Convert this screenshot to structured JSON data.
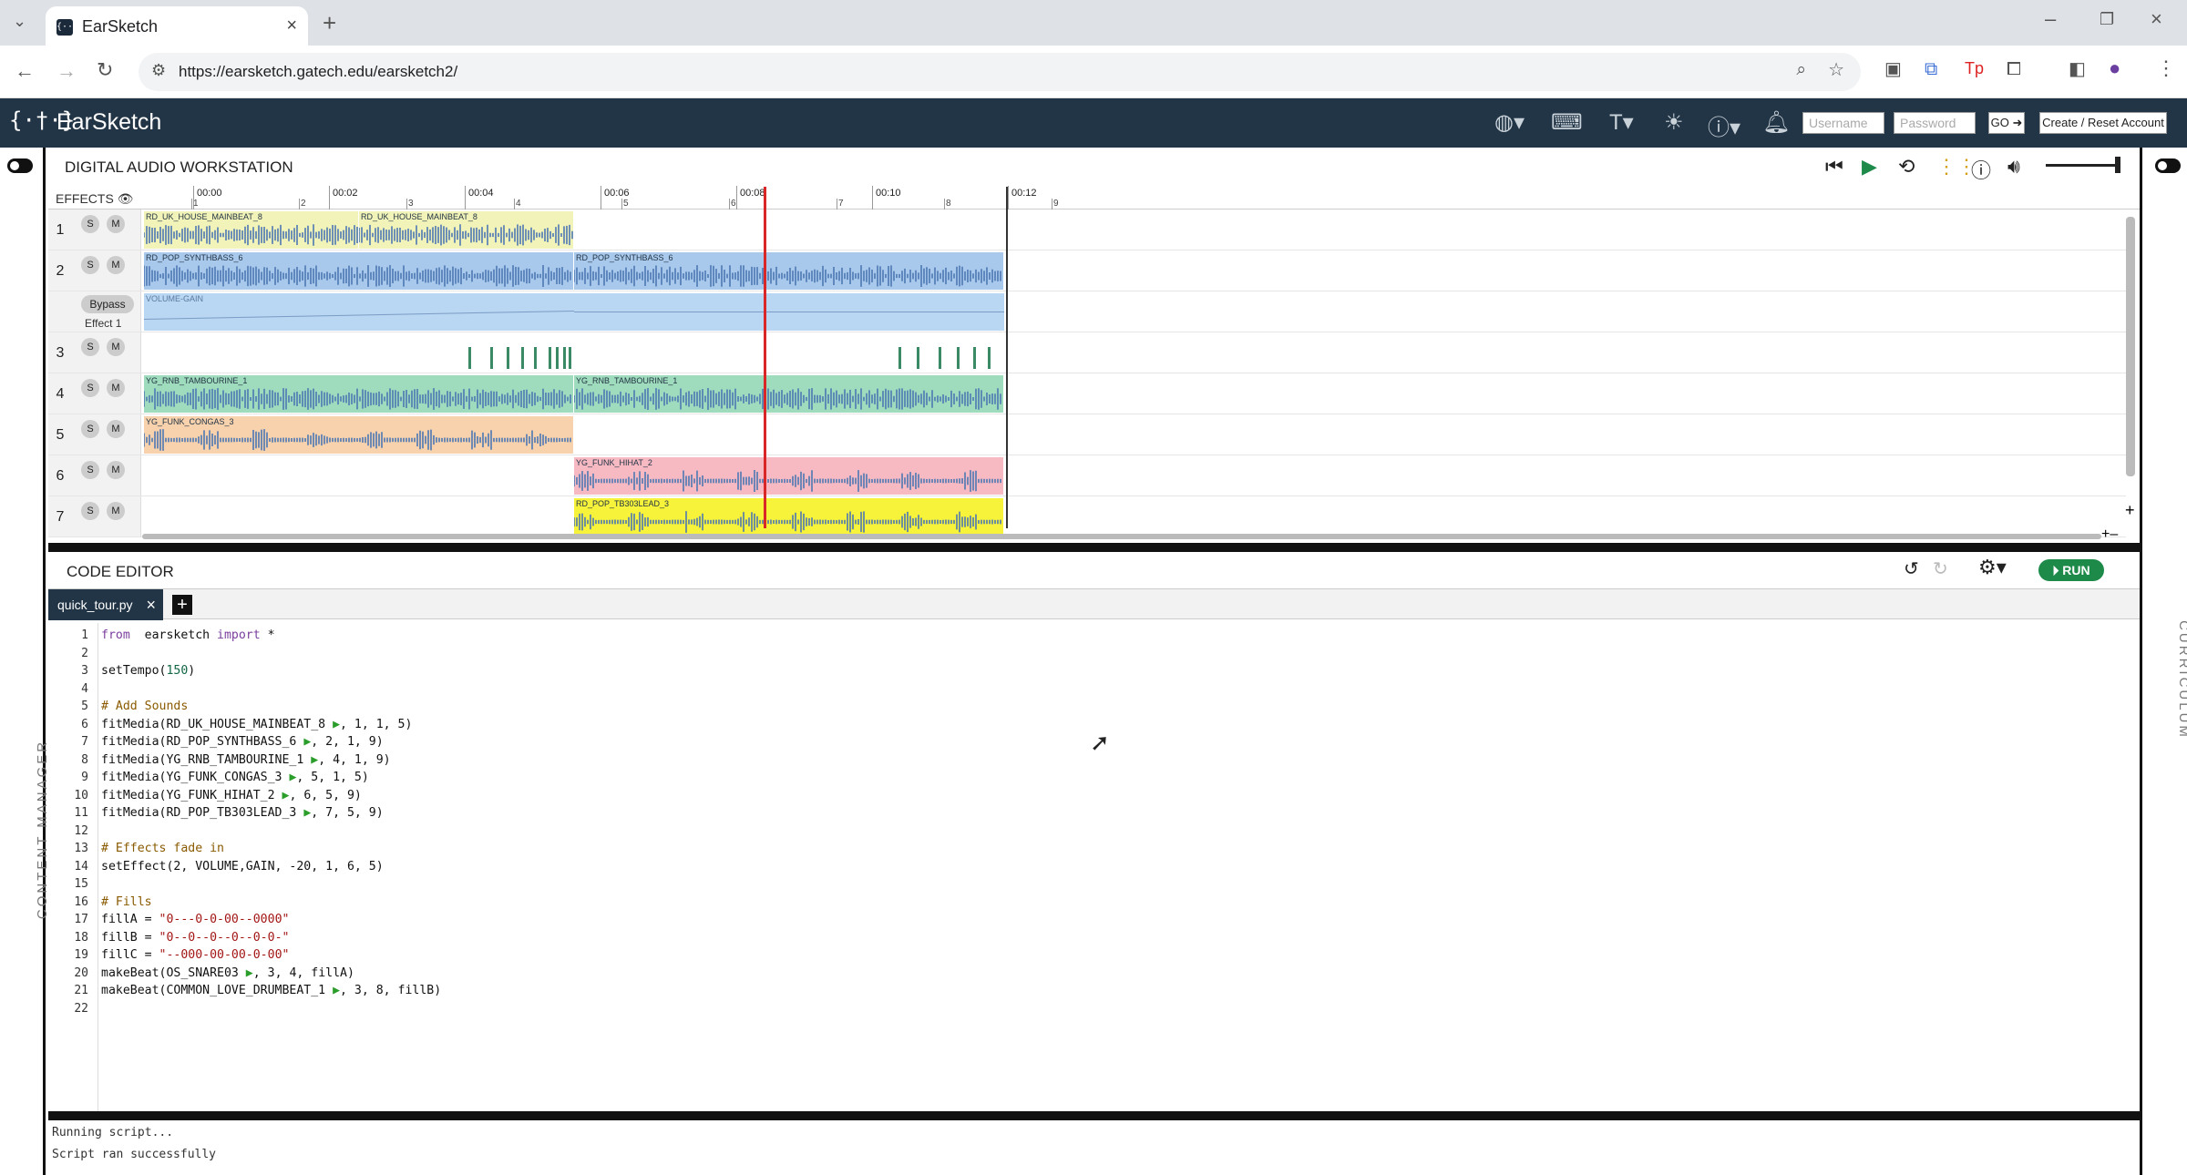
{
  "browser": {
    "tab_title": "EarSketch",
    "tab_favicon": "{··}",
    "url": "https://earsketch.gatech.edu/earsketch2/"
  },
  "app": {
    "logo": "{·†·}",
    "name": "EarSketch",
    "username_placeholder": "Username",
    "password_placeholder": "Password",
    "go_label": "GO",
    "create_account_label": "Create / Reset Account"
  },
  "side": {
    "left_label": "CONTENT MANAGER",
    "right_label": "CURRICULUM"
  },
  "daw": {
    "title": "DIGITAL AUDIO WORKSTATION",
    "effects_label": "EFFECTS",
    "time_labels": [
      "00:00",
      "00:02",
      "00:04",
      "00:06",
      "00:08",
      "00:10",
      "00:12"
    ],
    "measure_labels": [
      "1",
      "2",
      "3",
      "4",
      "5",
      "6",
      "7",
      "8",
      "9"
    ],
    "bypass_label": "Bypass",
    "effect_label": "Effect 1",
    "effect_clip": "VOLUME-GAIN",
    "tracks": [
      {
        "num": "1",
        "color": "#f1f3b8",
        "wave": "#4d78b3",
        "clips": [
          {
            "name": "RD_UK_HOUSE_MAINBEAT_8",
            "m1": 1,
            "m2": 3
          },
          {
            "name": "RD_UK_HOUSE_MAINBEAT_8",
            "m1": 3,
            "m2": 5
          }
        ]
      },
      {
        "num": "2",
        "color": "#a9c9ec",
        "wave": "#4d78b3",
        "clips": [
          {
            "name": "RD_POP_SYNTHBASS_6",
            "m1": 1,
            "m2": 5
          },
          {
            "name": "RD_POP_SYNTHBASS_6",
            "m1": 5,
            "m2": 9
          }
        ]
      },
      {
        "num": "3",
        "color": "#ffffff",
        "wave": "#3a8a66",
        "clips": [
          {
            "name": "",
            "m1": 1,
            "m2": 5
          },
          {
            "name": "",
            "m1": 5,
            "m2": 9
          }
        ]
      },
      {
        "num": "4",
        "color": "#9fdcbd",
        "wave": "#4d78b3",
        "clips": [
          {
            "name": "YG_RNB_TAMBOURINE_1",
            "m1": 1,
            "m2": 5
          },
          {
            "name": "YG_RNB_TAMBOURINE_1",
            "m1": 5,
            "m2": 9
          }
        ]
      },
      {
        "num": "5",
        "color": "#f7d2ad",
        "wave": "#4d78b3",
        "clips": [
          {
            "name": "YG_FUNK_CONGAS_3",
            "m1": 1,
            "m2": 5
          }
        ]
      },
      {
        "num": "6",
        "color": "#f7bac3",
        "wave": "#4d78b3",
        "clips": [
          {
            "name": "YG_FUNK_HIHAT_2",
            "m1": 5,
            "m2": 9
          }
        ]
      },
      {
        "num": "7",
        "color": "#f7f33a",
        "wave": "#4d78b3",
        "clips": [
          {
            "name": "RD_POP_TB303LEAD_3",
            "m1": 5,
            "m2": 9
          }
        ]
      }
    ],
    "solo_label": "S",
    "mute_label": "M"
  },
  "editor": {
    "title": "CODE EDITOR",
    "file_tab": "quick_tour.py",
    "run_label": "RUN",
    "lines": [
      [
        [
          "kw",
          "from"
        ],
        [
          "",
          "  earsketch "
        ],
        [
          "kw",
          "import"
        ],
        [
          "",
          " *"
        ]
      ],
      [],
      [
        [
          "",
          "setTempo("
        ],
        [
          "nu",
          "150"
        ],
        [
          "",
          ")"
        ]
      ],
      [],
      [
        [
          "cm",
          "# Add Sounds"
        ]
      ],
      [
        [
          "",
          "fitMedia(RD_UK_HOUSE_MAINBEAT_8 "
        ],
        [
          "pl",
          "▶"
        ],
        [
          "",
          ", 1, 1, 5)"
        ]
      ],
      [
        [
          "",
          "fitMedia(RD_POP_SYNTHBASS_6 "
        ],
        [
          "pl",
          "▶"
        ],
        [
          "",
          ", 2, 1, 9)"
        ]
      ],
      [
        [
          "",
          "fitMedia(YG_RNB_TAMBOURINE_1 "
        ],
        [
          "pl",
          "▶"
        ],
        [
          "",
          ", 4, 1, 9)"
        ]
      ],
      [
        [
          "",
          "fitMedia(YG_FUNK_CONGAS_3 "
        ],
        [
          "pl",
          "▶"
        ],
        [
          "",
          ", 5, 1, 5)"
        ]
      ],
      [
        [
          "",
          "fitMedia(YG_FUNK_HIHAT_2 "
        ],
        [
          "pl",
          "▶"
        ],
        [
          "",
          ", 6, 5, 9)"
        ]
      ],
      [
        [
          "",
          "fitMedia(RD_POP_TB303LEAD_3 "
        ],
        [
          "pl",
          "▶"
        ],
        [
          "",
          ", 7, 5, 9)"
        ]
      ],
      [],
      [
        [
          "cm",
          "# Effects fade in"
        ]
      ],
      [
        [
          "",
          "setEffect(2, VOLUME,GAIN, -20, 1, 6, 5)"
        ]
      ],
      [],
      [
        [
          "cm",
          "# Fills"
        ]
      ],
      [
        [
          "",
          "fillA = "
        ],
        [
          "st",
          "\"0---0-0-00--0000\""
        ]
      ],
      [
        [
          "",
          "fillB = "
        ],
        [
          "st",
          "\"0--0--0--0--0-0-\""
        ]
      ],
      [
        [
          "",
          "fillC = "
        ],
        [
          "st",
          "\"--000-00-00-0-00\""
        ]
      ],
      [
        [
          "",
          "makeBeat(OS_SNARE03 "
        ],
        [
          "pl",
          "▶"
        ],
        [
          "",
          ", 3, 4, fillA)"
        ]
      ],
      [
        [
          "",
          "makeBeat(COMMON_LOVE_DRUMBEAT_1 "
        ],
        [
          "pl",
          "▶"
        ],
        [
          "",
          ", 3, 8, fillB)"
        ]
      ],
      []
    ]
  },
  "console": {
    "lines": [
      "Running script...",
      "Script ran successfully"
    ]
  }
}
